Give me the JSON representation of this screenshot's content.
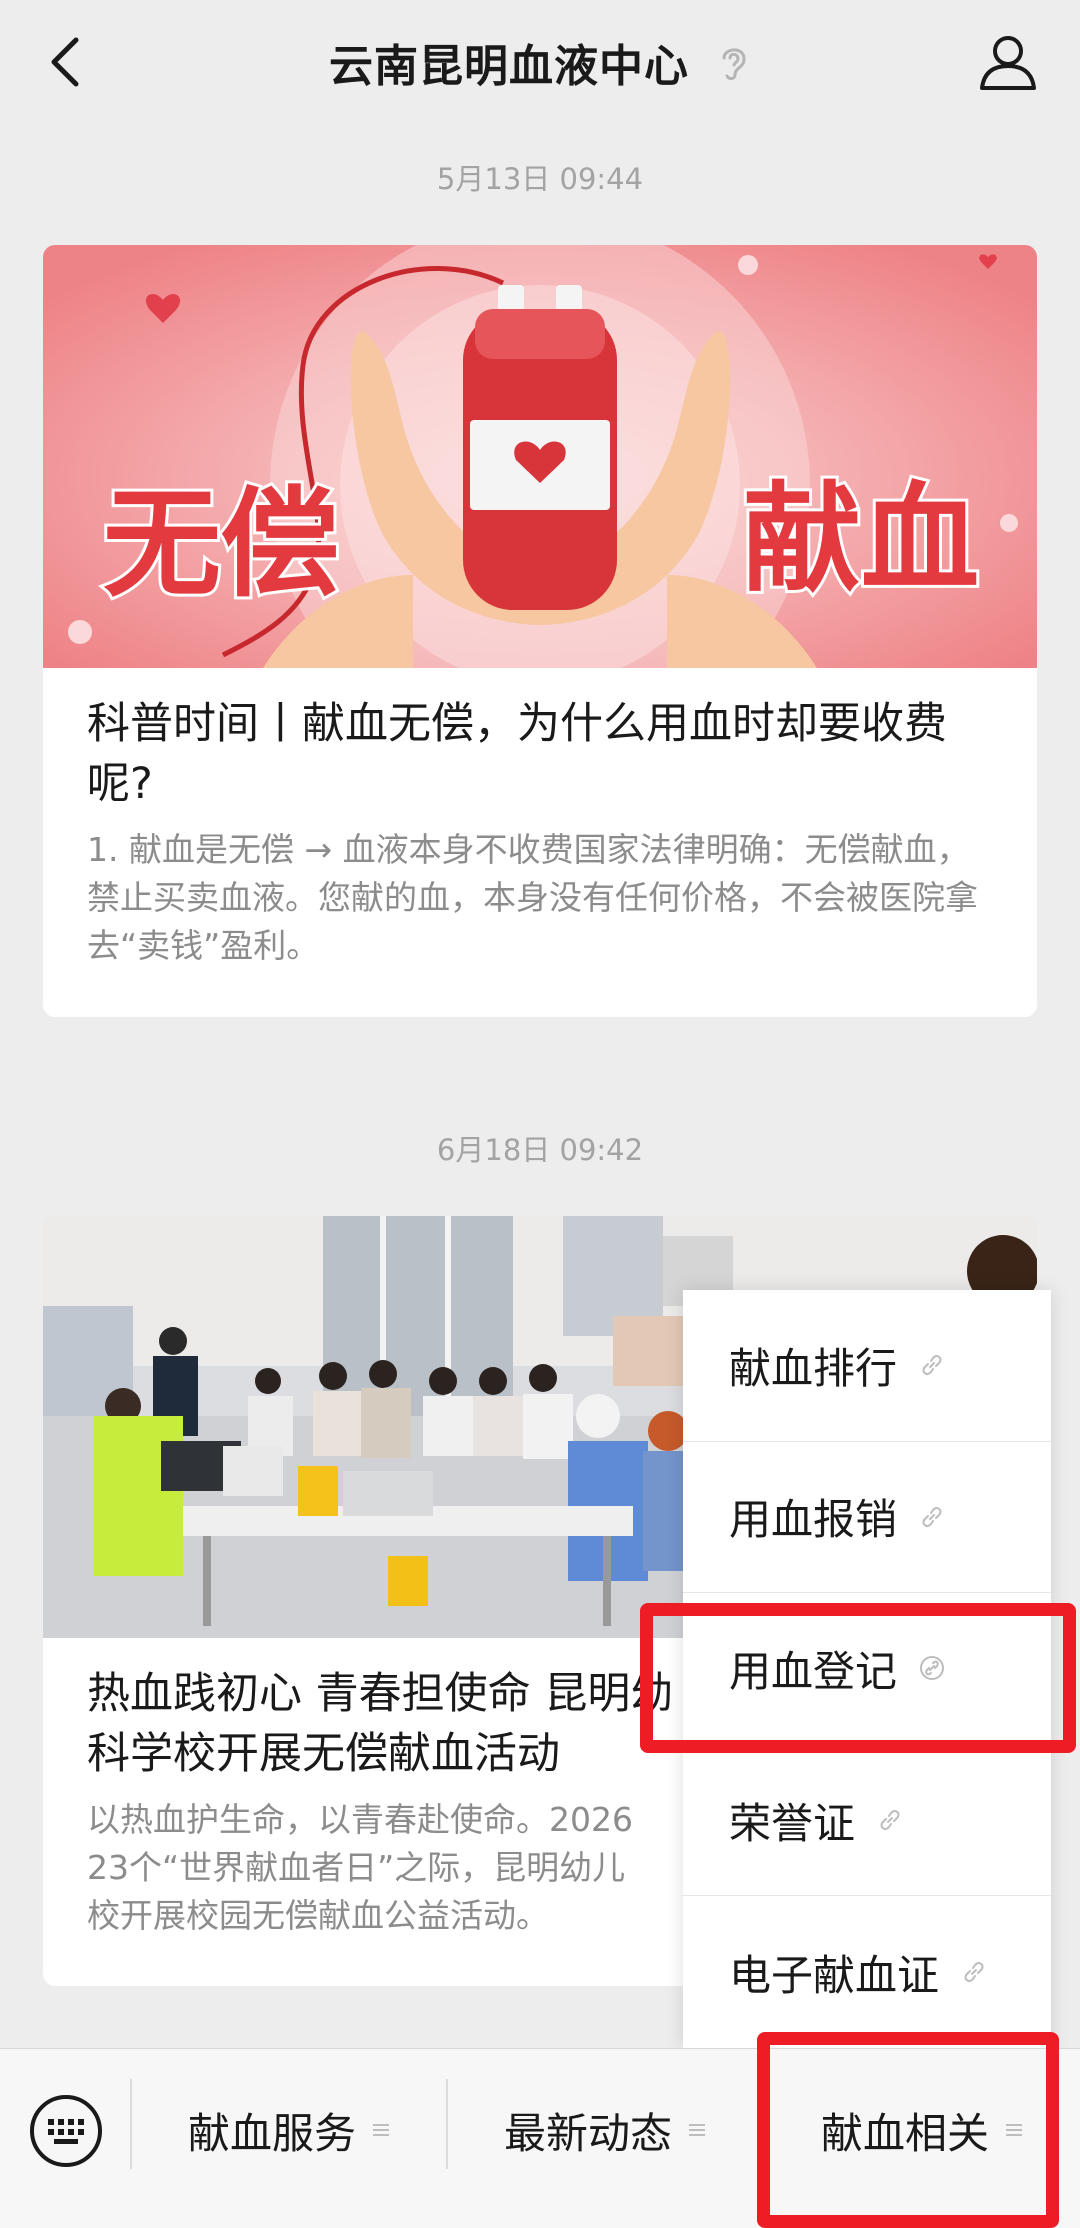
{
  "header": {
    "title": "云南昆明血液中心",
    "back_icon": "back-chevron-icon",
    "ear_icon": "ear-icon",
    "user_icon": "user-profile-icon"
  },
  "messages": [
    {
      "timestamp": "5月13日 09:44",
      "image_text_left": "无偿",
      "image_text_right": "献血",
      "title": "科普时间丨献血无偿，为什么用血时却要收费呢?",
      "desc": "1. 献血是无偿 → 血液本身不收费国家法律明确：无偿献血，禁止买卖血液。您献的血，本身没有任何价格，不会被医院拿去“卖钱”盈利。"
    },
    {
      "timestamp": "6月18日 09:42",
      "title": "热血践初心 青春担使命 昆明幼\n科学校开展无偿献血活动",
      "desc": "以热血护生命，以青春赴使命。2026\n23个“世界献血者日”之际，昆明幼儿\n校开展校园无偿献血公益活动。"
    }
  ],
  "popup_menu": {
    "items": [
      {
        "label": "献血排行",
        "icon": "link-icon"
      },
      {
        "label": "用血报销",
        "icon": "link-icon"
      },
      {
        "label": "用血登记",
        "icon": "link-icon"
      },
      {
        "label": "荣誉证",
        "icon": "link-icon"
      },
      {
        "label": "电子献血证",
        "icon": "link-icon"
      }
    ]
  },
  "bottom_menu": {
    "keyboard_icon": "keyboard-icon",
    "tabs": [
      {
        "label": "献血服务",
        "icon": "menu-lines-icon"
      },
      {
        "label": "最新动态",
        "icon": "menu-lines-icon"
      },
      {
        "label": "献血相关",
        "icon": "menu-lines-icon"
      }
    ]
  },
  "colors": {
    "background": "#ededed",
    "highlight_box": "#ee1c24",
    "banner_pink": "#f08a8e",
    "blood_red": "#d8353b"
  }
}
